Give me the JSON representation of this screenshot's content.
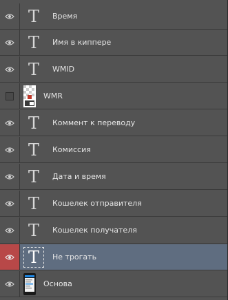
{
  "panel": {
    "layers": [
      {
        "name": "Время",
        "type": "text",
        "visible": true,
        "selected": false
      },
      {
        "name": "Имя в киппере",
        "type": "text",
        "visible": true,
        "selected": false
      },
      {
        "name": "WMID",
        "type": "text",
        "visible": true,
        "selected": false
      },
      {
        "name": "WMR",
        "type": "image",
        "visible": false,
        "selected": false
      },
      {
        "name": "Коммент к переводу",
        "type": "text",
        "visible": true,
        "selected": false
      },
      {
        "name": "Комиссия",
        "type": "text",
        "visible": true,
        "selected": false
      },
      {
        "name": "Дата и время",
        "type": "text",
        "visible": true,
        "selected": false
      },
      {
        "name": "Кошелек отправителя",
        "type": "text",
        "visible": true,
        "selected": false
      },
      {
        "name": "Кошелек получателя",
        "type": "text",
        "visible": true,
        "selected": false
      },
      {
        "name": "Не трогать",
        "type": "text",
        "visible": true,
        "selected": true
      },
      {
        "name": "Основа",
        "type": "image",
        "visible": true,
        "selected": false
      }
    ],
    "text_thumb_glyph": "T",
    "colors": {
      "panel_bg": "#535353",
      "selected_bg": "#5f6d80",
      "visibility_selected_bg": "#b84848",
      "text": "#e6e6e6"
    }
  }
}
